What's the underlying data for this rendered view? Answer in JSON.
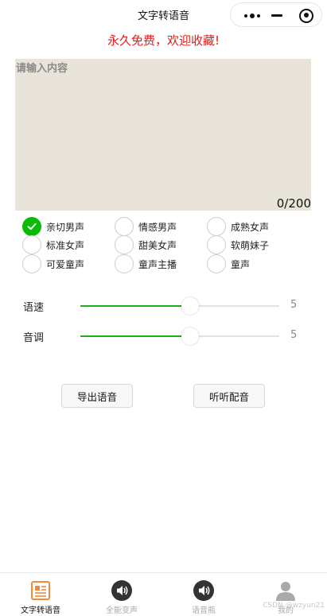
{
  "nav": {
    "title": "文字转语音"
  },
  "banner": {
    "text": "永久免费，欢迎收藏!"
  },
  "input": {
    "placeholder": "请输入内容",
    "counter": "0/200"
  },
  "voices": [
    {
      "label": "亲切男声",
      "selected": true
    },
    {
      "label": "情感男声",
      "selected": false
    },
    {
      "label": "成熟女声",
      "selected": false
    },
    {
      "label": "标准女声",
      "selected": false
    },
    {
      "label": "甜美女声",
      "selected": false
    },
    {
      "label": "软萌妹子",
      "selected": false
    },
    {
      "label": "可爱童声",
      "selected": false
    },
    {
      "label": "童声主播",
      "selected": false
    },
    {
      "label": "童声",
      "selected": false
    }
  ],
  "speed": {
    "label": "语速",
    "value": 5,
    "fraction": 0.55
  },
  "pitch": {
    "label": "音调",
    "value": 5,
    "fraction": 0.55
  },
  "buttons": {
    "export": "导出语音",
    "listen": "听听配音"
  },
  "tabs": [
    {
      "label": "文字转语音",
      "icon": "document-icon",
      "active": true
    },
    {
      "label": "全能变声",
      "icon": "speaker-icon",
      "active": false
    },
    {
      "label": "语音瓶",
      "icon": "speaker-icon",
      "active": false
    },
    {
      "label": "我的",
      "icon": "user-icon",
      "active": false
    }
  ],
  "watermark": "CSDN @wzyun21",
  "colors": {
    "accent": "#09bb07",
    "banner": "#e21b1b",
    "tab_active_icon": "#f08a3c"
  }
}
